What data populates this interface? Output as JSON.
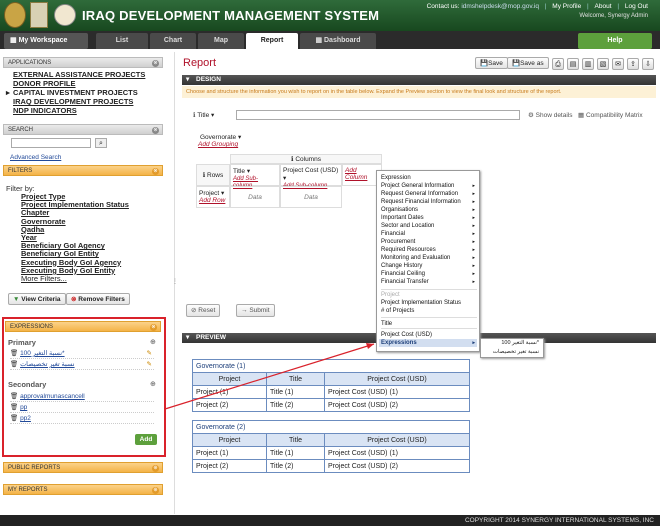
{
  "header": {
    "app_title": "IRAQ DEVELOPMENT MANAGEMENT SYSTEM",
    "contact_label": "Contact us:",
    "contact_email": "idmshelpdesk@mop.gov.iq",
    "my_profile": "My Profile",
    "about": "About",
    "logout": "Log Out",
    "welcome": "Welcome, Synergy Admin"
  },
  "nav": {
    "workspace": "My Workspace",
    "tabs": [
      "List",
      "Chart",
      "Map",
      "Report",
      "Dashboard"
    ],
    "active_tab": "Report",
    "help": "Help"
  },
  "sidebar": {
    "applications_title": "APPLICATIONS",
    "applications": [
      "EXTERNAL ASSISTANCE PROJECTS",
      "DONOR PROFILE",
      "CAPITAL INVESTMENT PROJECTS",
      "IRAQ DEVELOPMENT PROJECTS",
      "NDP INDICATORS"
    ],
    "search_title": "SEARCH",
    "advanced_search": "Advanced Search",
    "filters_title": "FILTERS",
    "filter_by": "Filter by:",
    "filters": [
      "Project Type",
      "Project Implementation Status",
      "Chapter",
      "Governorate",
      "Qadha",
      "Year",
      "Beneficiary GoI Agency",
      "Beneficiary GoI Entity",
      "Executing Body GoI Agency",
      "Executing Body GoI Entity",
      "More Filters..."
    ],
    "view_criteria": "View Criteria",
    "remove_filters": "Remove Filters",
    "expressions_title": "EXPRESSIONS",
    "primary_label": "Primary",
    "primary_items": [
      "نسبة التغير 100*",
      "نسبة تغير تخصيصات"
    ],
    "secondary_label": "Secondary",
    "secondary_items": [
      "approvalmunascancell",
      "pp",
      "pp2"
    ],
    "add_button": "Add",
    "public_reports": "PUBLIC REPORTS",
    "my_reports": "MY REPORTS"
  },
  "report": {
    "title": "Report",
    "toolbar": {
      "save": "Save",
      "save_as": "Save as"
    },
    "design_title": "DESIGN",
    "instructions": "Choose and structure the information you wish to report on in the table below. Expand the Preview section to view the final look and structure of the report.",
    "title_label": "Title",
    "show_details": "Show details",
    "compatibility_matrix": "Compatibility Matrix",
    "governorate": "Governorate",
    "add_grouping": "Add Grouping",
    "columns_label": "Columns",
    "rows_label": "Rows",
    "col_title": "Title",
    "col_cost": "Project Cost (USD)",
    "add_column": "Add Column",
    "add_subcolumn": "Add Sub-column",
    "row_project": "Project",
    "add_row": "Add Row",
    "data": "Data",
    "reset": "Reset",
    "submit": "Submit"
  },
  "context_menu": {
    "items": [
      "Expression",
      "Project General Information",
      "Request General Information",
      "Request Financial Information",
      "Organisations",
      "Important Dates",
      "Sector and Location",
      "Financial",
      "Procurement",
      "Required Resources",
      "Monitoring and Evaluation",
      "Change History",
      "Financial Ceiling",
      "Financial Transfer"
    ],
    "disabled_project": "Project",
    "items2": [
      "Project Implementation Status",
      "# of Projects"
    ],
    "title_item": "Title",
    "cost_item": "Project Cost (USD)",
    "expressions_item": "Expressions",
    "submenu": [
      "نسبة التغير 100*",
      "نسبة تغير تخصيصات"
    ]
  },
  "preview": {
    "title": "PREVIEW",
    "groups": [
      {
        "name": "Governorate (1)",
        "headers": [
          "Project",
          "Title",
          "Project Cost (USD)"
        ],
        "rows": [
          [
            "Project (1)",
            "Title (1)",
            "Project Cost (USD) (1)"
          ],
          [
            "Project (2)",
            "Title (2)",
            "Project Cost (USD) (2)"
          ]
        ]
      },
      {
        "name": "Governorate (2)",
        "headers": [
          "Project",
          "Title",
          "Project Cost (USD)"
        ],
        "rows": [
          [
            "Project (1)",
            "Title (1)",
            "Project Cost (USD) (1)"
          ],
          [
            "Project (2)",
            "Title (2)",
            "Project Cost (USD) (2)"
          ]
        ]
      }
    ]
  },
  "footer": "COPYRIGHT 2014 SYNERGY INTERNATIONAL SYSTEMS, INC"
}
